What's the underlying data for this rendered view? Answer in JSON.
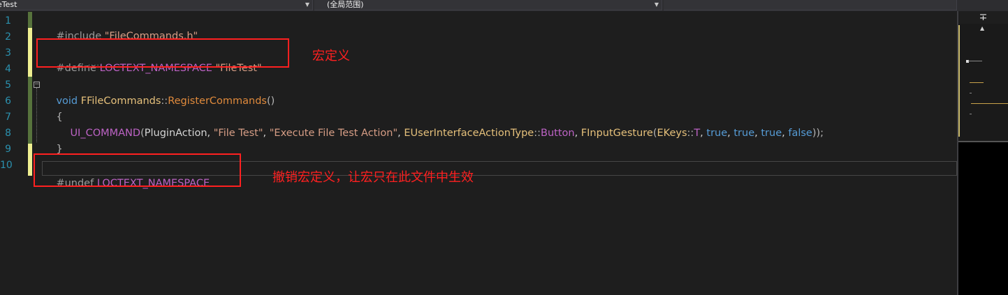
{
  "toolbar": {
    "project_dropdown": "eTest",
    "scope_dropdown": "(全局范围)",
    "member_dropdown": "",
    "split_button": "∓"
  },
  "editor": {
    "line_numbers": [
      "1",
      "2",
      "3",
      "4",
      "5",
      "6",
      "7",
      "8",
      "9",
      "10"
    ],
    "lines": {
      "l1": {
        "directive": "#include ",
        "path": "\"FileCommands.h\""
      },
      "l3": {
        "directive": "#define ",
        "macro": "LOCTEXT_NAMESPACE",
        "sp": " ",
        "value": "\"FileTest\""
      },
      "l5": {
        "kw": "void",
        "sp": " ",
        "cls": "FFileCommands",
        "sep": "::",
        "fn": "RegisterCommands",
        "paren": "()"
      },
      "l6": {
        "brace": "{"
      },
      "l7": {
        "macro": "UI_COMMAND",
        "open": "(",
        "arg1": "PluginAction, ",
        "arg2": "\"File Test\"",
        "c1": ", ",
        "arg3": "\"Execute File Test Action\"",
        "c2": ", ",
        "enum_type": "EUserInterfaceActionType",
        "sep1": "::",
        "enum_val": "Button",
        "c3": ", ",
        "ctor": "FInputGesture",
        "open2": "(",
        "keys": "EKeys",
        "sep2": "::",
        "key": "T",
        "c4": ", ",
        "b1": "true",
        "c5": ", ",
        "b2": "true",
        "c6": ", ",
        "b3": "true",
        "c7": ", ",
        "b4": "false",
        "close": "));"
      },
      "l8": {
        "brace": "}"
      },
      "l10": {
        "directive": "#undef ",
        "macro": "LOCTEXT_NAMESPACE"
      }
    },
    "squiggle": "....."
  },
  "annotations": {
    "note1": "宏定义",
    "note2": "撤销宏定义，让宏只在此文件中生效"
  },
  "colors": {
    "annotation": "#ff2020",
    "editor_bg": "#1e1e1e",
    "line_number": "#2b91af"
  }
}
